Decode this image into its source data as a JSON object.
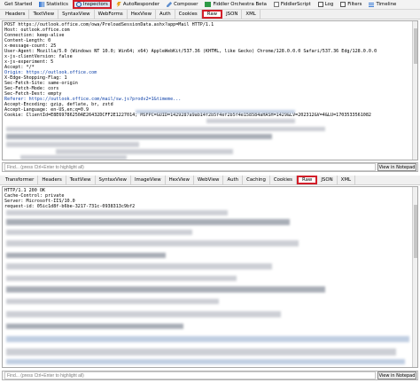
{
  "toolbar": {
    "items": [
      {
        "label": "Get Started",
        "icon": "none"
      },
      {
        "label": "Statistics",
        "icon": "chart-icon"
      },
      {
        "label": "Inspectors",
        "icon": "inspectors-icon",
        "highlight": true
      },
      {
        "label": "AutoResponder",
        "icon": "bolt-icon"
      },
      {
        "label": "Composer",
        "icon": "composer-icon"
      },
      {
        "label": "Fiddler Orchestra Beta",
        "icon": "fo-icon"
      },
      {
        "label": "FiddlerScript",
        "icon": "script-icon"
      },
      {
        "label": "Log",
        "icon": "log-icon"
      },
      {
        "label": "Filters",
        "icon": "filters-icon"
      },
      {
        "label": "Timeline",
        "icon": "timeline-icon"
      }
    ]
  },
  "request_tabs": [
    {
      "label": "Headers"
    },
    {
      "label": "TextView"
    },
    {
      "label": "SyntaxView"
    },
    {
      "label": "WebForms"
    },
    {
      "label": "HexView"
    },
    {
      "label": "Auth"
    },
    {
      "label": "Cookies"
    },
    {
      "label": "Raw",
      "highlight": true
    },
    {
      "label": "JSON"
    },
    {
      "label": "XML"
    }
  ],
  "request_lines": [
    "POST https://outlook.office.com/owa/PreloadSessionData.ashx?app=Mail HTTP/1.1",
    "Host: outlook.office.com",
    "Connection: keep-alive",
    "Content-Length: 0",
    "x-message-count: 25",
    "User-Agent: Mozilla/5.0 (Windows NT 10.0; Win64; x64) AppleWebKit/537.36 (KHTML, like Gecko) Chrome/128.0.0.0 Safari/537.36 Edg/128.0.0.0",
    "x-js-clientVersion: false",
    "x-js-experiment: 5",
    "Accept: */*",
    "Origin: https://outlook.office.com",
    "X-Edge-Shopping-Flag: 1",
    "Sec-Fetch-Site: same-origin",
    "Sec-Fetch-Mode: cors",
    "Sec-Fetch-Dest: empty",
    "Referer: https://outlook.office.com/mail/sw.js?prodv2=1&timeme...",
    "Accept-Encoding: gzip, deflate, br, zstd",
    "Accept-Language: en-US,en;q=0.9",
    "Cookie: ClientId=E8E69786250AE26432DCFF2E1227014; MSFPC=GUID=1429287a9ab14f2b5f4ef2b5f4e158584aHASH=1429&LV=202312&V=4&LU=1703533561082"
  ],
  "response_tabs": [
    {
      "label": "Transformer"
    },
    {
      "label": "Headers"
    },
    {
      "label": "TextView"
    },
    {
      "label": "SyntaxView"
    },
    {
      "label": "ImageView"
    },
    {
      "label": "HexView"
    },
    {
      "label": "WebView"
    },
    {
      "label": "Auth"
    },
    {
      "label": "Caching"
    },
    {
      "label": "Cookies"
    },
    {
      "label": "Raw",
      "highlight": true
    },
    {
      "label": "JSON"
    },
    {
      "label": "XML"
    }
  ],
  "response_lines": [
    "HTTP/1.1 200 OK",
    "Cache-Control: private",
    "Server: Microsoft-IIS/10.0",
    "request-id: 05ic1d8f-b6be-3217-731c-0938313c9bf2"
  ],
  "find": {
    "placeholder": "Find... (press Ctrl+Enter to highlight all)",
    "notepad_label": "View in Notepad"
  },
  "colors": {
    "highlight": "#d21f2a",
    "link": "#0b3fa8"
  }
}
